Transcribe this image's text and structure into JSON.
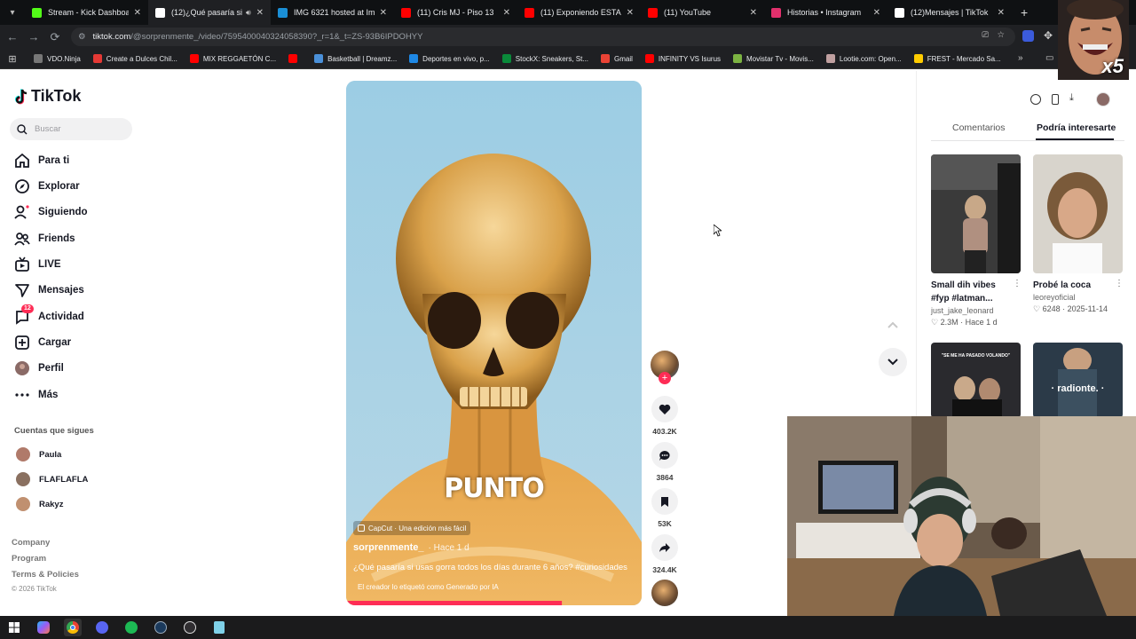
{
  "browser": {
    "tabs": [
      {
        "title": "Stream - Kick Dashboard",
        "color": "#53fc18"
      },
      {
        "title": "(12)¿Qué pasaría si u",
        "color": "#ffffff",
        "audio": true
      },
      {
        "title": "IMG 6321 hosted at ImgB",
        "color": "#1a8fd6"
      },
      {
        "title": "(11) Cris MJ - Piso 13",
        "color": "#ff0000",
        "extra": true
      },
      {
        "title": "(11) Exponiendo ESTAFAS",
        "color": "#ff0000"
      },
      {
        "title": "(11) YouTube",
        "color": "#ff0000"
      },
      {
        "title": "Historias • Instagram",
        "color": "#e1306c"
      },
      {
        "title": "(12)Mensajes | TikTok",
        "color": "#ffffff"
      }
    ],
    "new_tab": "+",
    "url_host": "tiktok.com",
    "url_path": "/@sorprenmente_/video/7595400040324058390?_r=1&_t=ZS-93B6IPDOHYY",
    "bookmarks": [
      {
        "label": "VDO.Ninja",
        "color": "#777"
      },
      {
        "label": "Create a Dulces Chil...",
        "color": "#e53935"
      },
      {
        "label": "MIX REGGAETÓN C...",
        "color": "#ff0000"
      },
      {
        "label": "",
        "color": "#ff0000"
      },
      {
        "label": "Basketball | Dreamz...",
        "color": "#4a90d9"
      },
      {
        "label": "Deportes en vivo, p...",
        "color": "#1e88e5"
      },
      {
        "label": "StockX: Sneakers, St...",
        "color": "#0a8a3a"
      },
      {
        "label": "Gmail",
        "color": "#ea4335"
      },
      {
        "label": "INFINITY VS Isurus",
        "color": "#ff0000"
      },
      {
        "label": "Movistar Tv - Movis...",
        "color": "#7cb342"
      },
      {
        "label": "Lootie.com: Open...",
        "color": "#c0a0a0"
      },
      {
        "label": "FREST - Mercado Sa...",
        "color": "#ffcc00"
      }
    ],
    "bookmarks_more": "»",
    "overlay_badge": "x5"
  },
  "tiktok": {
    "logo": "TikTok",
    "search_placeholder": "Buscar",
    "nav": [
      {
        "label": "Para ti",
        "icon": "home-icon"
      },
      {
        "label": "Explorar",
        "icon": "compass-icon"
      },
      {
        "label": "Siguiendo",
        "icon": "following-icon"
      },
      {
        "label": "Friends",
        "icon": "friends-icon"
      },
      {
        "label": "LIVE",
        "icon": "live-icon"
      },
      {
        "label": "Mensajes",
        "icon": "messages-icon"
      },
      {
        "label": "Actividad",
        "icon": "activity-icon",
        "badge": "12"
      },
      {
        "label": "Cargar",
        "icon": "upload-icon"
      },
      {
        "label": "Perfil",
        "icon": "profile-icon"
      },
      {
        "label": "Más",
        "icon": "more-icon"
      }
    ],
    "following_title": "Cuentas que sigues",
    "following": [
      {
        "name": "Paula",
        "color": "#b07a6a"
      },
      {
        "name": "FLAFLAFLA",
        "color": "#8a7060"
      },
      {
        "name": "Rakyz",
        "color": "#c09070"
      }
    ],
    "footer": [
      "Company",
      "Program",
      "Terms & Policies",
      "© 2026 TikTok"
    ],
    "video": {
      "caption_word": "PUNTO",
      "capcut": "CapCut · Una edición más fácil",
      "author": "sorprenmente_",
      "time": "· Hace 1 d",
      "description": "¿Qué pasaría si usas gorra todos los días durante 6 años? #curiosidades",
      "ai_label": "El creador lo etiquetó como Generado por IA",
      "progress": 0.73
    },
    "actions": {
      "likes": "403.2K",
      "comments": "3864",
      "saves": "53K",
      "shares": "324.4K"
    },
    "right": {
      "tab_comments": "Comentarios",
      "tab_suggested": "Podría interesarte",
      "cards": [
        {
          "title": "Small dih vibes #fyp #latman...",
          "user": "just_jake_leonard",
          "likes": "2.3M",
          "date": "Hace 1 d"
        },
        {
          "title": "Probé la coca",
          "user": "leoreyoficial",
          "likes": "6248",
          "date": "2025-11-14"
        },
        {
          "overlay_text": "\"SE ME HA PASADO VOLANDO\""
        },
        {
          "overlay_text": "· radionte. ·"
        }
      ]
    }
  }
}
